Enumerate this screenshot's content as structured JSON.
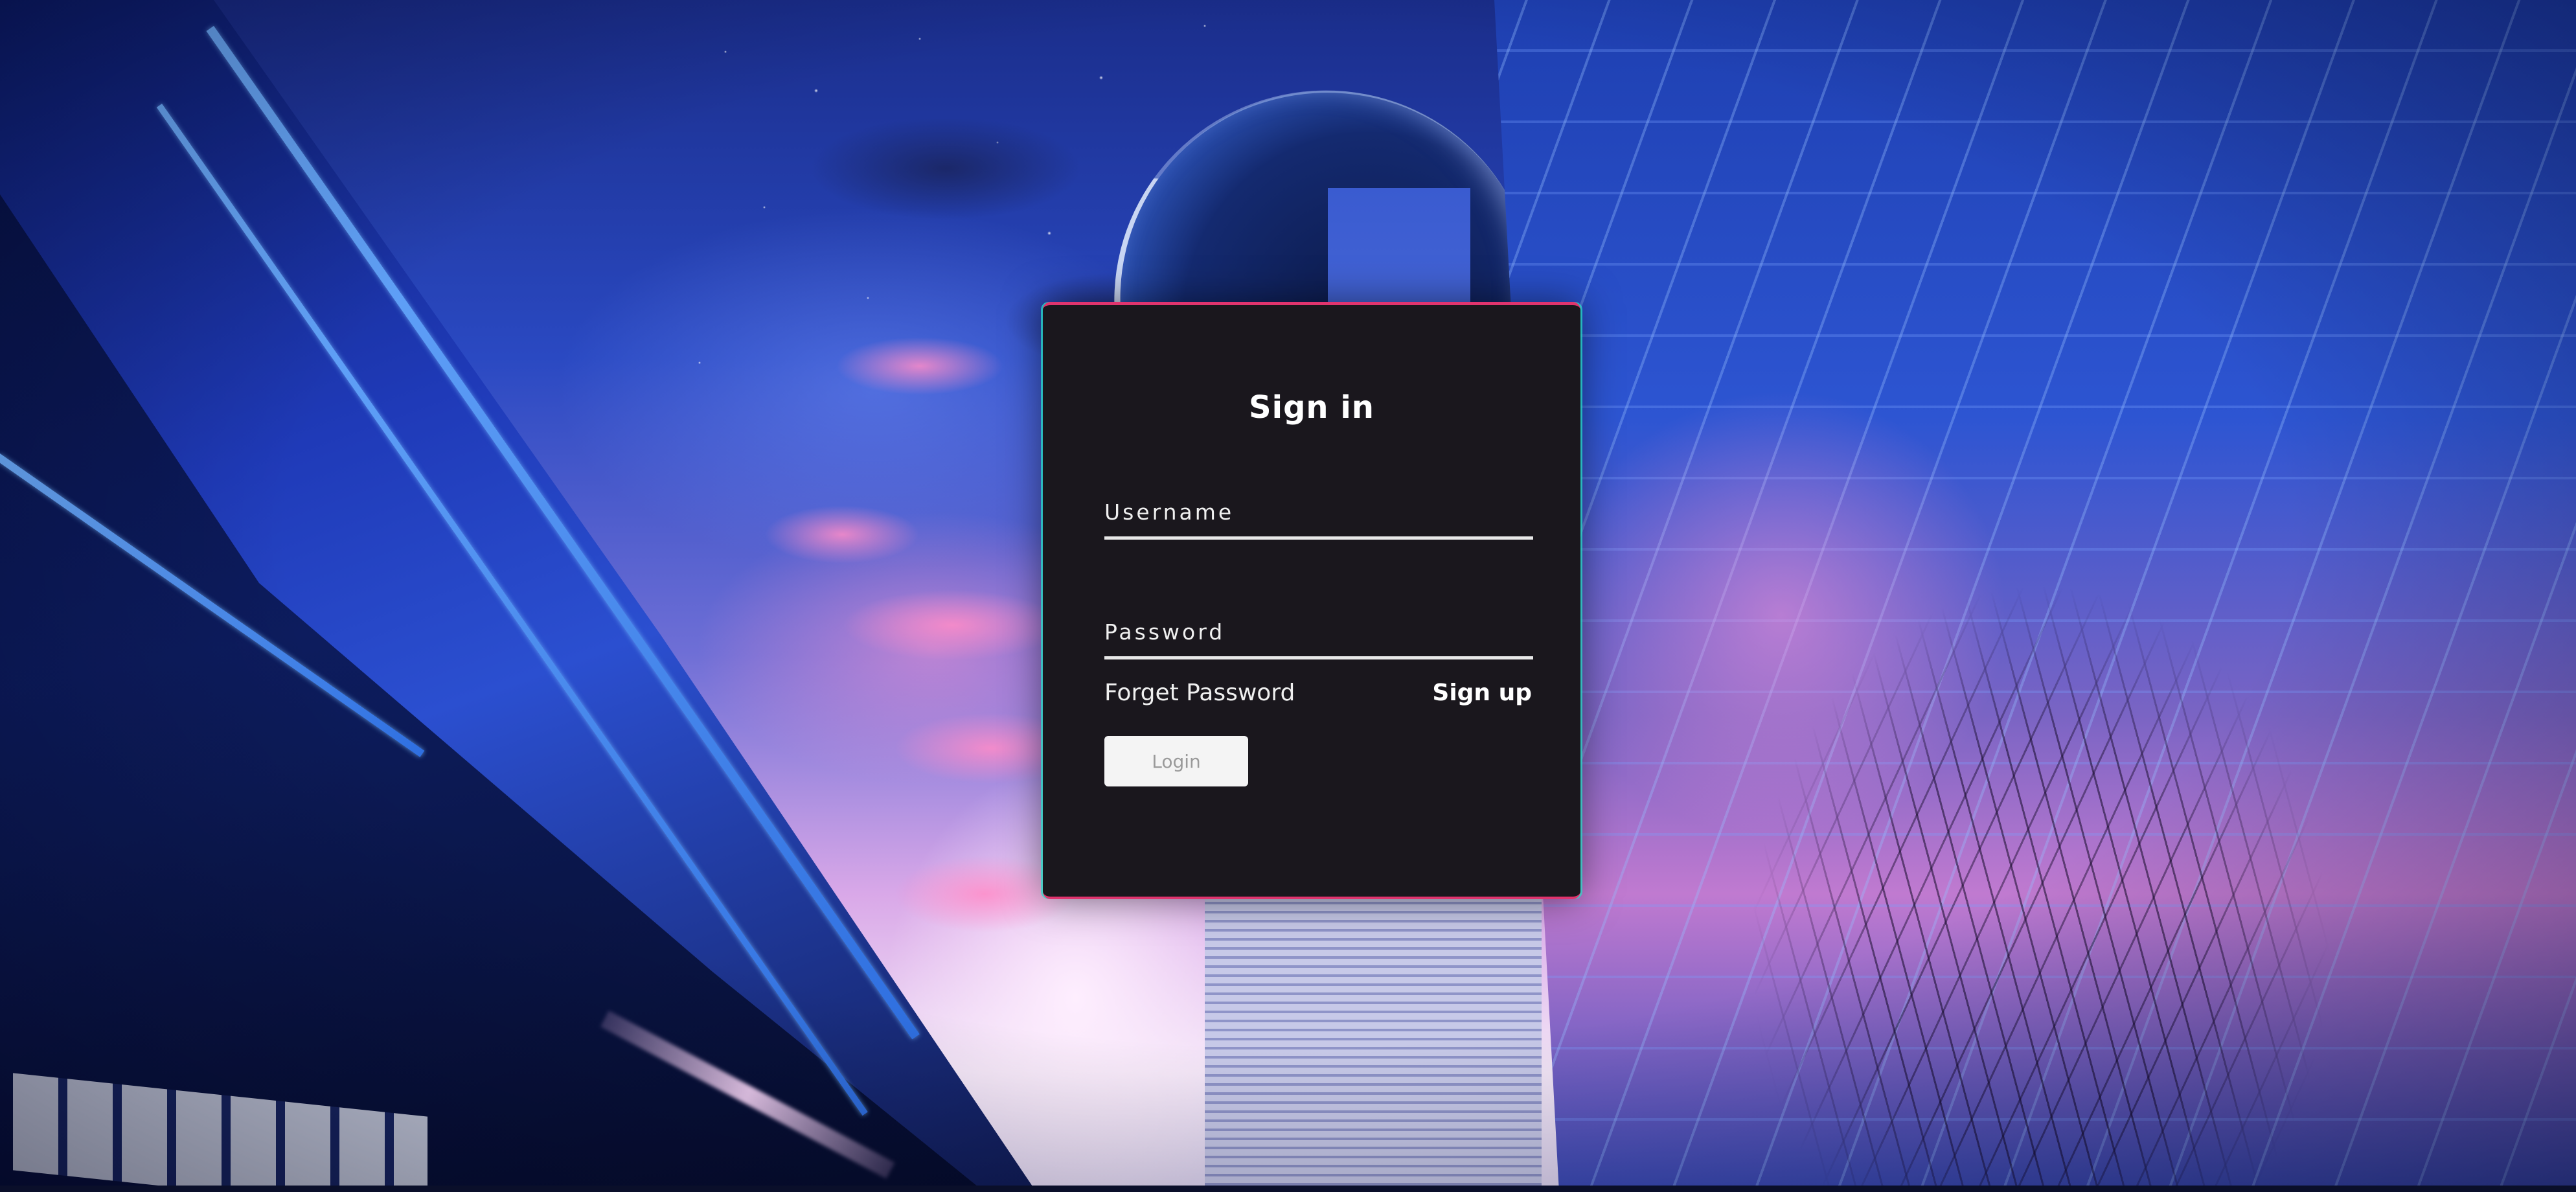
{
  "login_form": {
    "title": "Sign in",
    "username_label": "Username",
    "username_value": "",
    "password_label": "Password",
    "password_value": "",
    "forget_password_label": "Forget Password",
    "signup_label": "Sign up",
    "login_button_label": "Login"
  },
  "theme": {
    "card_background": "#1a171d",
    "card_accent_top": "#e0346e",
    "card_accent_side": "#28dcc8",
    "text_color": "#ffffff",
    "button_background": "#f4f4f4"
  },
  "background": {
    "icon": "night-city-wallpaper"
  }
}
